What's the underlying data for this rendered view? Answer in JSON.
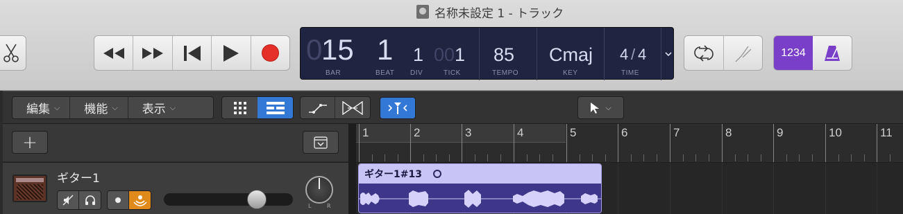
{
  "window": {
    "title": "名称未設定 1 - トラック"
  },
  "lcd": {
    "bar_dim": "0",
    "bar": "15",
    "beat": "1",
    "div": "1",
    "tick_dim": "00",
    "tick": "1",
    "tempo": "85",
    "key": "Cmaj",
    "time_num": "4",
    "time_den": "4",
    "labels": {
      "bar": "BAR",
      "beat": "BEAT",
      "div": "DIV",
      "tick": "TICK",
      "tempo": "TEMPO",
      "key": "KEY",
      "time": "TIME"
    }
  },
  "count_in": {
    "label": "1234"
  },
  "menus": [
    {
      "label": "編集"
    },
    {
      "label": "機能"
    },
    {
      "label": "表示"
    }
  ],
  "ruler": {
    "bars": [
      "1",
      "2",
      "3",
      "4",
      "5",
      "6",
      "7",
      "8",
      "9",
      "10",
      "11"
    ]
  },
  "track": {
    "name": "ギター1",
    "pan_left": "L",
    "pan_right": "R",
    "region": {
      "name": "ギター1#13"
    }
  },
  "colors": {
    "accent_blue": "#3478d6",
    "count_in_purple": "#7a3fc9",
    "record_red": "#e5302a",
    "input_orange": "#e08a1c",
    "region_header": "#c9c4f6",
    "region_body": "#3d3689",
    "lcd_bg": "#1f2440"
  }
}
